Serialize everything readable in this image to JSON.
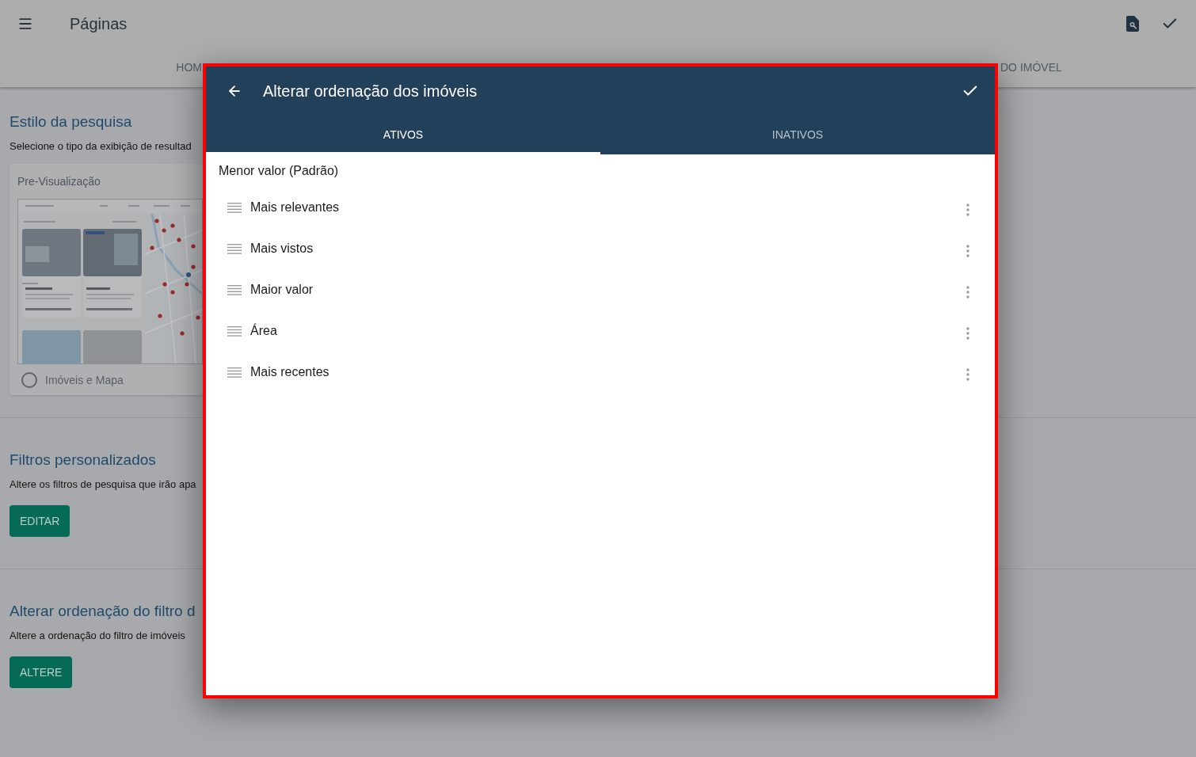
{
  "app_bar": {
    "title": "Páginas"
  },
  "page_tabs": [
    {
      "label": "HOM"
    },
    {
      "label": "DO IMÓVEL"
    }
  ],
  "sections": [
    {
      "kind": "preview",
      "title": "Estilo da pesquisa",
      "description": "Selecione o tipo da exibição de resultad",
      "preview": {
        "label": "Pre-Visualização",
        "option": {
          "label": "Imóveis e Mapa",
          "selected": false
        }
      }
    },
    {
      "kind": "action",
      "title": "Filtros personalizados",
      "description": "Altere os filtros de pesquisa que irão apa",
      "button": "EDITAR"
    },
    {
      "kind": "action",
      "title": "Alterar ordenação do filtro d",
      "description": "Altere a ordenação do filtro de imóveis",
      "button": "ALTERE"
    }
  ],
  "dialog": {
    "title": "Alterar ordenação dos imóveis",
    "tabs": [
      {
        "label": "ATIVOS",
        "selected": true
      },
      {
        "label": "INATIVOS",
        "selected": false
      }
    ],
    "default_option": "Menor valor (Padrão)",
    "items": [
      "Mais relevantes",
      "Mais vistos",
      "Maior valor",
      "Área",
      "Mais recentes"
    ]
  }
}
